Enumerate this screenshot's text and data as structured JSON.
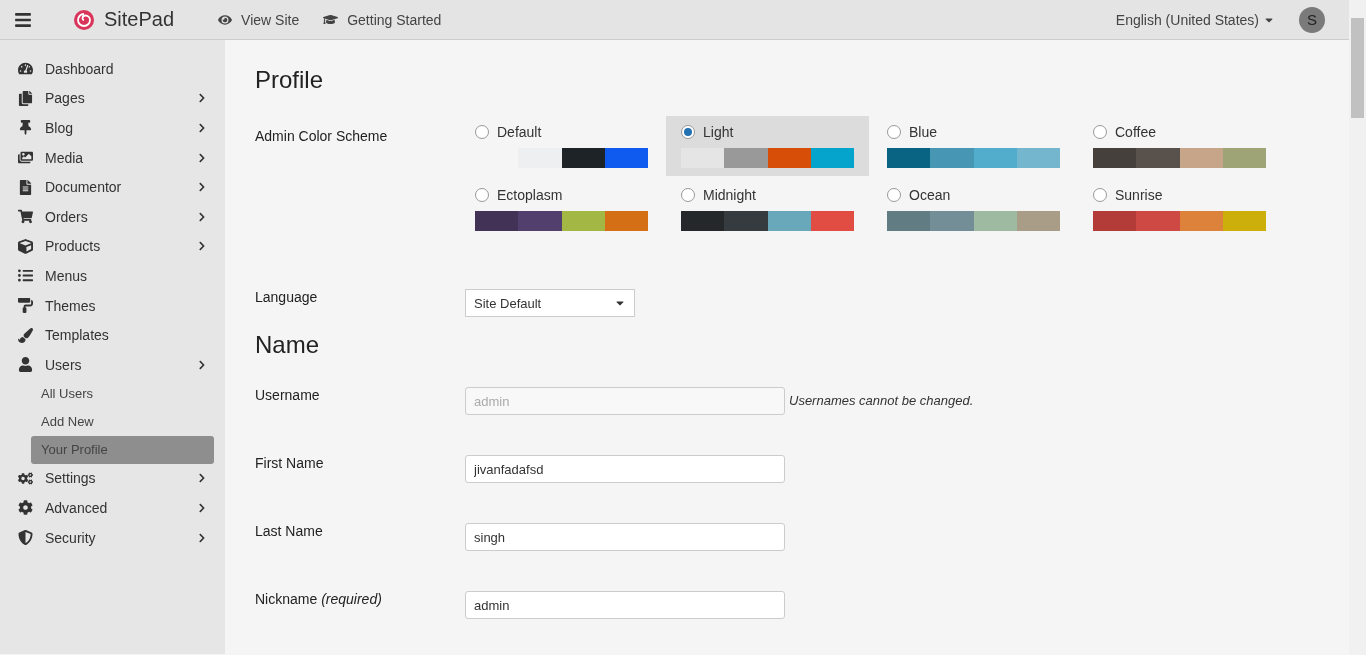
{
  "topbar": {
    "brand": "SitePad",
    "links": [
      {
        "label": "View Site",
        "kind": "eye"
      },
      {
        "label": "Getting Started",
        "kind": "cap"
      }
    ],
    "language": "English (United States)",
    "avatar": "S"
  },
  "sidebar": {
    "items": [
      {
        "label": "Dashboard",
        "expandable": false
      },
      {
        "label": "Pages",
        "expandable": true
      },
      {
        "label": "Blog",
        "expandable": true
      },
      {
        "label": "Media",
        "expandable": true
      },
      {
        "label": "Documentor",
        "expandable": true
      },
      {
        "label": "Orders",
        "expandable": true
      },
      {
        "label": "Products",
        "expandable": true
      },
      {
        "label": "Menus",
        "expandable": false
      },
      {
        "label": "Themes",
        "expandable": false
      },
      {
        "label": "Templates",
        "expandable": false
      },
      {
        "label": "Users",
        "expandable": true,
        "children": [
          {
            "label": "All Users",
            "selected": false
          },
          {
            "label": "Add New",
            "selected": false
          },
          {
            "label": "Your Profile",
            "selected": true
          }
        ]
      },
      {
        "label": "Settings",
        "expandable": true
      },
      {
        "label": "Advanced",
        "expandable": true
      },
      {
        "label": "Security",
        "expandable": true
      }
    ]
  },
  "profile": {
    "title": "Profile",
    "color_scheme": {
      "label": "Admin Color Scheme",
      "schemes": [
        {
          "name": "Default",
          "selected": false,
          "swatches": [
            {
              "color": "#eeeff0"
            },
            {
              "color": "#1d2327"
            },
            {
              "color": "#0f5bf0"
            }
          ]
        },
        {
          "name": "Light",
          "selected": true,
          "swatches": [
            {
              "color": "#e5e5e5"
            },
            {
              "color": "#999999"
            },
            {
              "color": "#d64e07"
            },
            {
              "color": "#04a4cc"
            }
          ]
        },
        {
          "name": "Blue",
          "selected": false,
          "swatches": [
            {
              "color": "#096484"
            },
            {
              "color": "#4796b3"
            },
            {
              "color": "#52accc"
            },
            {
              "color": "#74b6ce"
            }
          ]
        },
        {
          "name": "Coffee",
          "selected": false,
          "swatches": [
            {
              "color": "#46403c"
            },
            {
              "color": "#59524c"
            },
            {
              "color": "#c7a589"
            },
            {
              "color": "#9ea476"
            }
          ]
        },
        {
          "name": "Ectoplasm",
          "selected": false,
          "swatches": [
            {
              "color": "#413256"
            },
            {
              "color": "#523f6d"
            },
            {
              "color": "#a3b745"
            },
            {
              "color": "#d46f15"
            }
          ]
        },
        {
          "name": "Midnight",
          "selected": false,
          "swatches": [
            {
              "color": "#25282b"
            },
            {
              "color": "#363b3f"
            },
            {
              "color": "#69a8bb"
            },
            {
              "color": "#e14d43"
            }
          ]
        },
        {
          "name": "Ocean",
          "selected": false,
          "swatches": [
            {
              "color": "#627c83"
            },
            {
              "color": "#738e96"
            },
            {
              "color": "#9ebaa0"
            },
            {
              "color": "#aa9d88"
            }
          ]
        },
        {
          "name": "Sunrise",
          "selected": false,
          "swatches": [
            {
              "color": "#b43c38"
            },
            {
              "color": "#cf4944"
            },
            {
              "color": "#dd823b"
            },
            {
              "color": "#ccaf0b"
            }
          ]
        }
      ]
    },
    "language": {
      "label": "Language",
      "value": "Site Default"
    }
  },
  "name_section": {
    "title": "Name",
    "fields": [
      {
        "label": "Username",
        "value": "admin",
        "disabled": true,
        "note": "Usernames cannot be changed."
      },
      {
        "label": "First Name",
        "value": "jivanfadafsd",
        "disabled": false
      },
      {
        "label": "Last Name",
        "value": "singh",
        "disabled": false
      },
      {
        "label": "Nickname *(required)*",
        "value": "admin",
        "disabled": false
      }
    ]
  }
}
